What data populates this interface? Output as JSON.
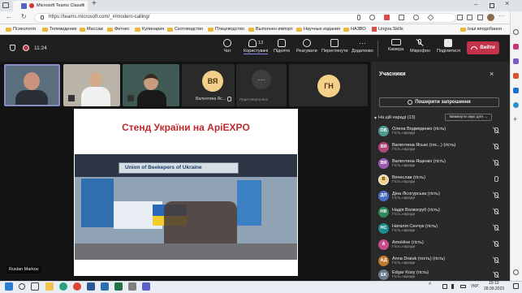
{
  "browser": {
    "tab_title": "Microsoft Teams Classic",
    "url": "https://teams.microsoft.com/_#/modern-calling/",
    "bookmarks": [
      "Психологія",
      "Телевидение",
      "Массаж",
      "Фитнес",
      "Кулинария",
      "Скотоводство",
      "Птицеводство",
      "Выполнен импорт",
      "Научные издания",
      "НАЗВО",
      "Lingva.Skills",
      "Інші вподобання"
    ]
  },
  "teams": {
    "meeting_time": "11:24",
    "participant_count": "13",
    "toolbar": {
      "chat": "Чат",
      "people": "Користувачі",
      "raise": "Підняти",
      "react": "Реагувати",
      "view": "Переглянути",
      "more": "Додатково",
      "camera": "Камера",
      "mic": "Мікрофон",
      "share": "Поділитися",
      "leave": "Вийти"
    },
    "tiles": {
      "t4_initials": "ВЯ",
      "t4_name": "Валентина Яс...",
      "t5_hint": "Переглянути все",
      "t6_initials": "ГН"
    },
    "presenter_name": "Ruslan Markov",
    "slide": {
      "title": "Стенд України на ApiEXPO",
      "banner": "Union of Beekepers of Ukraine"
    },
    "panel": {
      "title": "Учасники",
      "share_invite": "Поширити запрошення",
      "section": "На цій нараді (13)",
      "mute_all": "Вимкнути звук для ...",
      "participants": [
        {
          "initials": "ОВ",
          "name": "Олена Водмеденко (гість)",
          "role": "Гість наради",
          "color": "#4f9b8f",
          "mic": "off"
        },
        {
          "initials": "ВЯ",
          "name": "Валентина Ясько (гос...) (гість)",
          "role": "Гість наради",
          "color": "#b0467a",
          "mic": "off"
        },
        {
          "initials": "ВЯ",
          "name": "Валентина Ященко (гість)",
          "role": "Гість наради",
          "color": "#9c5ab4",
          "mic": "off"
        },
        {
          "initials": "В",
          "name": "Вячеслав (гість)",
          "role": "Гість наради",
          "color": "#f2d08a",
          "mic": "on"
        },
        {
          "initials": "ДЛ",
          "name": "Діна Лісогурська (гість)",
          "role": "Гість наради",
          "color": "#4b6fc8",
          "mic": "off"
        },
        {
          "initials": "НВ",
          "name": "Надія Волкогруб (гість)",
          "role": "Гість наради",
          "color": "#2f8a5a",
          "mic": "off"
        },
        {
          "initials": "НС",
          "name": "Наталія Сенчук (гість)",
          "role": "Гість наради",
          "color": "#1e8c8c",
          "mic": "off"
        },
        {
          "initials": "А",
          "name": "AmoHive (гість)",
          "role": "Гість наради",
          "color": "#c44d8a",
          "mic": "off"
        },
        {
          "initials": "АД",
          "name": "Anna Draiuk (гость) (гість)",
          "role": "Гість наради",
          "color": "#c27a2e",
          "mic": "off"
        },
        {
          "initials": "ЕК",
          "name": "Edgar Kosy (гість)",
          "role": "Гість наради",
          "color": "#6b7c8c",
          "mic": "off"
        }
      ]
    }
  },
  "taskbar": {
    "lang": "УКР",
    "time": "15:13",
    "date": "28.09.2023"
  }
}
